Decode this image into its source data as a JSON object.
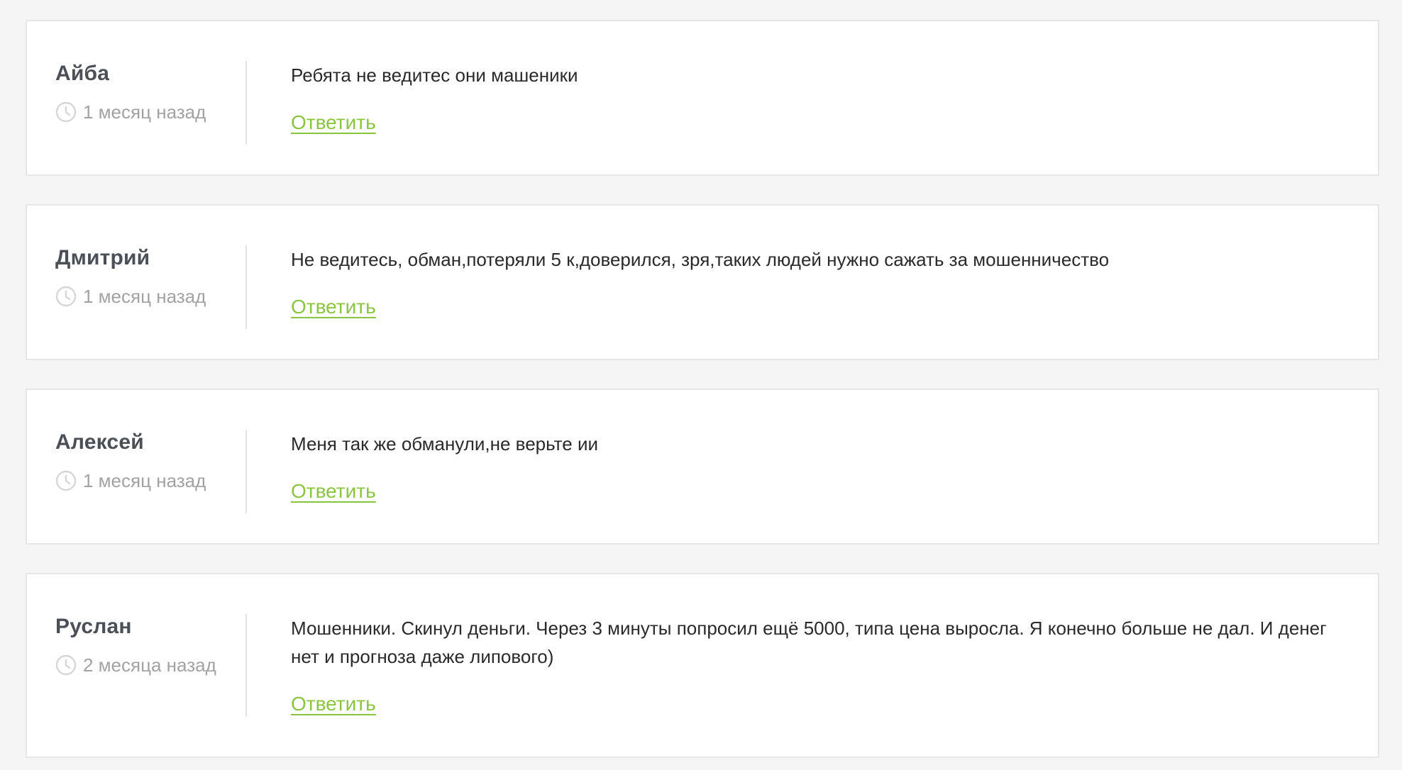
{
  "comments": [
    {
      "author": "Айба",
      "date": "1 месяц назад",
      "text": "Ребята не ведитес они машеники",
      "reply_label": "Ответить"
    },
    {
      "author": "Дмитрий",
      "date": "1 месяц назад",
      "text": "Не ведитесь, обман,потеряли 5 к,доверился, зря,таких людей нужно сажать за мошенничество",
      "reply_label": "Ответить"
    },
    {
      "author": "Алексей",
      "date": "1 месяц назад",
      "text": "Меня так же обманули,не верьте ии",
      "reply_label": "Ответить"
    },
    {
      "author": "Руслан",
      "date": "2 месяца назад",
      "text": "Мошенники. Скинул деньги. Через 3 минуты попросил ещё 5000, типа цена выросла. Я конечно больше не дал. И денег нет и прогноза даже липового)",
      "reply_label": "Ответить"
    }
  ],
  "colors": {
    "page_background": "#f5f5f5",
    "card_background": "#ffffff",
    "author": "#4b4f56",
    "date": "#a2a2a2",
    "text": "#2a2a2a",
    "reply_link": "#8bc53f"
  },
  "icons": {
    "date_icon": "clock-icon"
  }
}
